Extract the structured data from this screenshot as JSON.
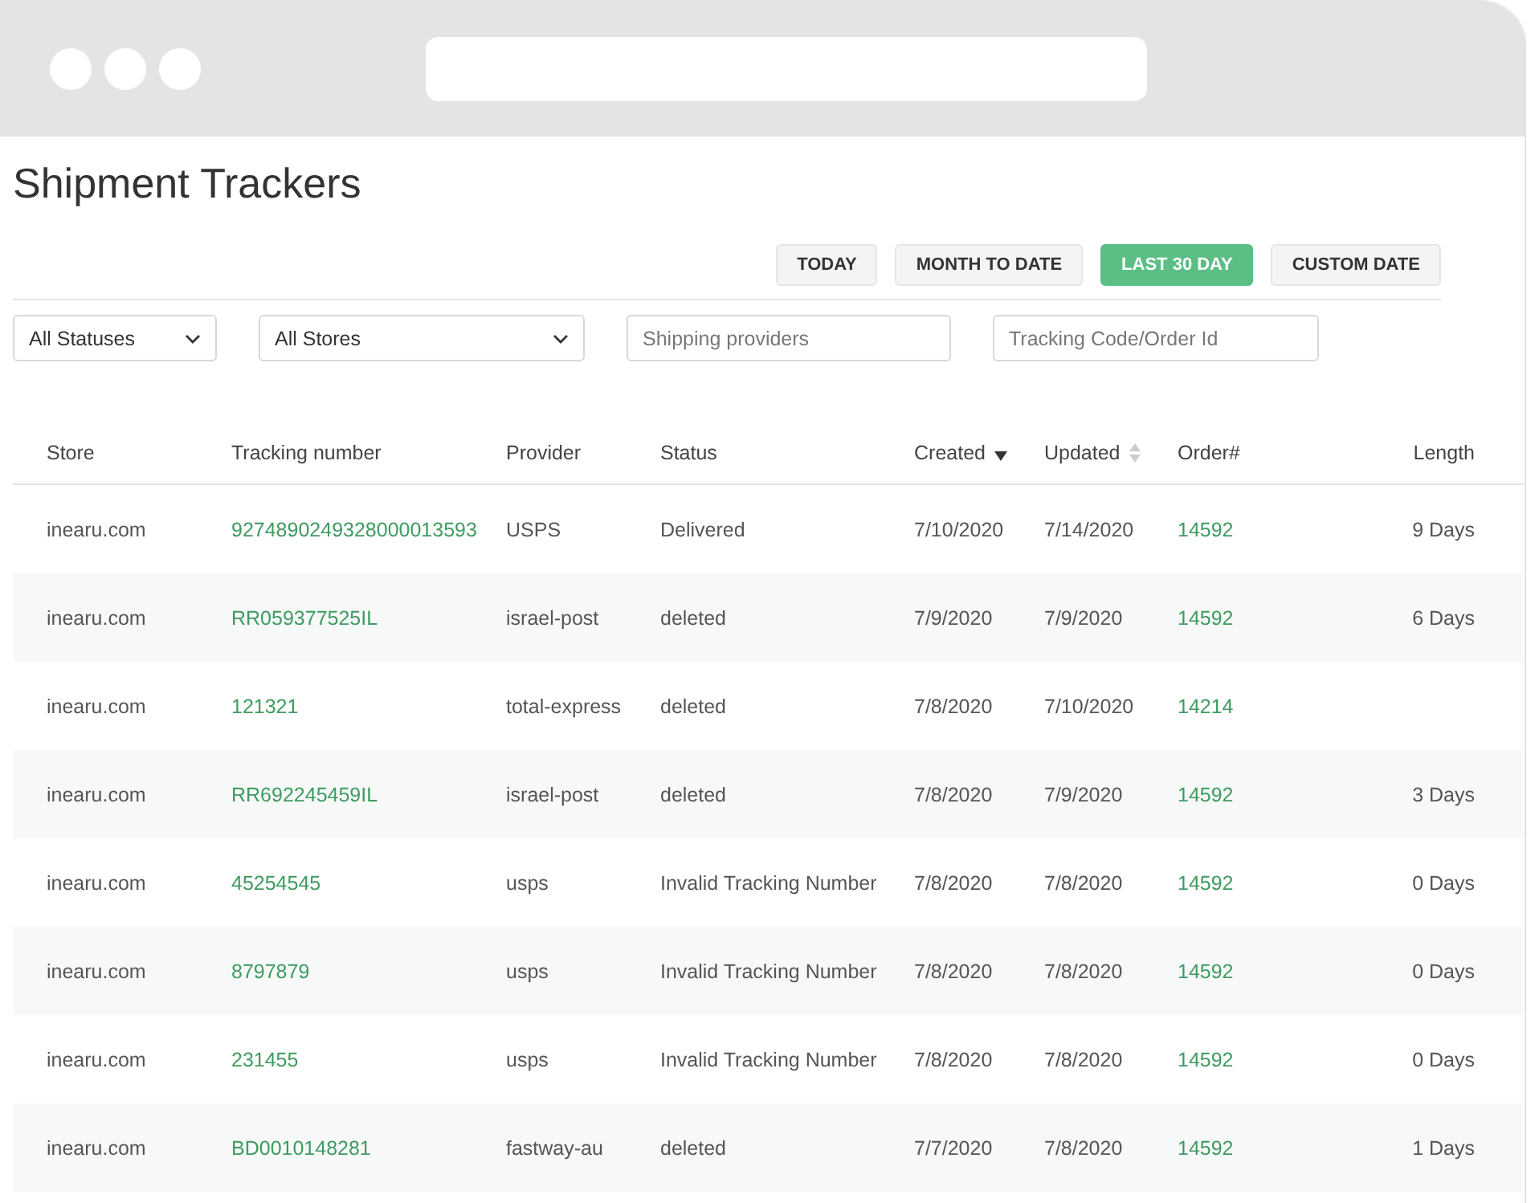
{
  "page": {
    "title": "Shipment Trackers"
  },
  "date_ranges": [
    {
      "label": "TODAY",
      "selected": false
    },
    {
      "label": "MONTH TO DATE",
      "selected": false
    },
    {
      "label": "LAST 30 DAY",
      "selected": true
    },
    {
      "label": "CUSTOM DATE",
      "selected": false
    }
  ],
  "filters": [
    {
      "kind": "dropdown",
      "value": "All Statuses"
    },
    {
      "kind": "dropdown",
      "value": "All Stores"
    },
    {
      "kind": "input",
      "placeholder": "Shipping providers"
    },
    {
      "kind": "input",
      "placeholder": "Tracking Code/Order Id"
    }
  ],
  "table": {
    "columns": [
      {
        "label": "Store",
        "kind": "plain"
      },
      {
        "label": "Tracking number",
        "kind": "plain"
      },
      {
        "label": "Provider",
        "kind": "plain"
      },
      {
        "label": "Status",
        "kind": "plain"
      },
      {
        "label": "Created",
        "kind": "sortable",
        "sorted": true
      },
      {
        "label": "Updated",
        "kind": "sortable",
        "sorted": false
      },
      {
        "label": "Order#",
        "kind": "plain"
      },
      {
        "label": "Length",
        "kind": "plain"
      }
    ],
    "rows": [
      {
        "store": "inearu.com",
        "tracking": "9274890249328000013593",
        "provider": "USPS",
        "status": "Delivered",
        "created": "7/10/2020",
        "updated": "7/14/2020",
        "order": "14592",
        "length": "9 Days"
      },
      {
        "store": "inearu.com",
        "tracking": "RR059377525IL",
        "provider": "israel-post",
        "status": "deleted",
        "created": "7/9/2020",
        "updated": "7/9/2020",
        "order": "14592",
        "length": "6 Days"
      },
      {
        "store": "inearu.com",
        "tracking": "121321",
        "provider": "total-express",
        "status": "deleted",
        "created": "7/8/2020",
        "updated": "7/10/2020",
        "order": "14214"
      },
      {
        "store": "inearu.com",
        "tracking": "RR692245459IL",
        "provider": "israel-post",
        "status": "deleted",
        "created": "7/8/2020",
        "updated": "7/9/2020",
        "order": "14592",
        "length": "3 Days"
      },
      {
        "store": "inearu.com",
        "tracking": "45254545",
        "provider": "usps",
        "status": "Invalid Tracking Number",
        "created": "7/8/2020",
        "updated": "7/8/2020",
        "order": "14592",
        "length": "0 Days"
      },
      {
        "store": "inearu.com",
        "tracking": "8797879",
        "provider": "usps",
        "status": "Invalid Tracking Number",
        "created": "7/8/2020",
        "updated": "7/8/2020",
        "order": "14592",
        "length": "0 Days"
      },
      {
        "store": "inearu.com",
        "tracking": "231455",
        "provider": "usps",
        "status": "Invalid Tracking Number",
        "created": "7/8/2020",
        "updated": "7/8/2020",
        "order": "14592",
        "length": "0 Days"
      },
      {
        "store": "inearu.com",
        "tracking": "BD0010148281",
        "provider": "fastway-au",
        "status": "deleted",
        "created": "7/7/2020",
        "updated": "7/8/2020",
        "order": "14592",
        "length": "1 Days"
      }
    ]
  }
}
